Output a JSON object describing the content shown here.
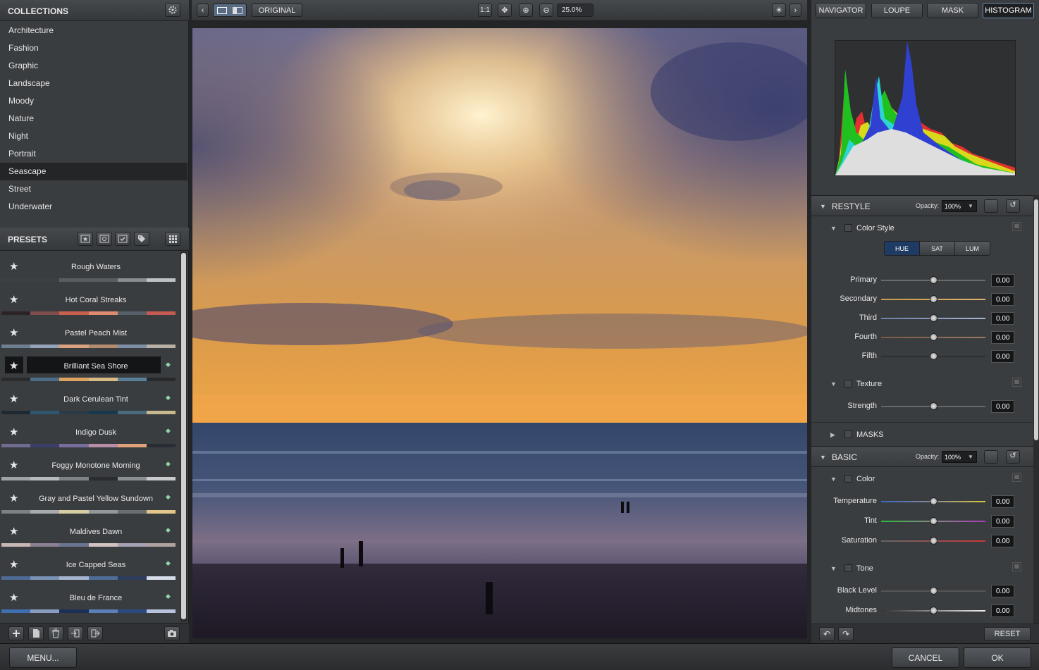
{
  "collections": {
    "title": "COLLECTIONS",
    "items": [
      "Architecture",
      "Fashion",
      "Graphic",
      "Landscape",
      "Moody",
      "Nature",
      "Night",
      "Portrait",
      "Seascape",
      "Street",
      "Underwater"
    ],
    "selected": "Seascape"
  },
  "presets": {
    "title": "PRESETS",
    "items": [
      {
        "name": "Rough Waters",
        "swatch": [
          "#3d4043",
          "#3d4043",
          "#5a5d60",
          "#5a5d60",
          "#8a8c8e",
          "#bfc1c3"
        ],
        "dot": false
      },
      {
        "name": "Hot Coral Streaks",
        "swatch": [
          "#2d2226",
          "#7f4d4c",
          "#c95f4f",
          "#e08a6f",
          "#55606b",
          "#c45a52"
        ],
        "dot": false
      },
      {
        "name": "Pastel Peach Mist",
        "swatch": [
          "#6f7f92",
          "#93a2b6",
          "#d9a17e",
          "#b38b6f",
          "#7e8fa5",
          "#b8b0a4"
        ],
        "dot": false
      },
      {
        "name": "Brilliant Sea Shore",
        "swatch": [
          "#2a2b2c",
          "#4b6d8a",
          "#dba35f",
          "#d7bb83",
          "#5a7f9a",
          "#27292b"
        ],
        "dot": true,
        "selected": true
      },
      {
        "name": "Dark Cerulean Tint",
        "swatch": [
          "#1e2a33",
          "#2f5870",
          "#2c3a47",
          "#18384d",
          "#4a6a7d",
          "#c9b98f"
        ],
        "dot": true
      },
      {
        "name": "Indigo Dusk",
        "swatch": [
          "#6f6c8f",
          "#3a3f67",
          "#7a6f9c",
          "#b88da6",
          "#e0a17a",
          "#2a2c34"
        ],
        "dot": true
      },
      {
        "name": "Foggy Monotone Morning",
        "swatch": [
          "#9fa3a6",
          "#b8bbbd",
          "#7f8386",
          "#2a2c2f",
          "#8b8f93",
          "#c7c9cb"
        ],
        "dot": true
      },
      {
        "name": "Gray and Pastel Yellow Sundown",
        "swatch": [
          "#7d8084",
          "#a9abad",
          "#d6cda3",
          "#95989b",
          "#6b6e72",
          "#e1c88a"
        ],
        "dot": true
      },
      {
        "name": "Maldives Dawn",
        "swatch": [
          "#c9b7b6",
          "#8c7f91",
          "#6b7590",
          "#d2c3c1",
          "#a8a1b3",
          "#b1a0a0"
        ],
        "dot": true
      },
      {
        "name": "Ice Capped Seas",
        "swatch": [
          "#4e6a97",
          "#7b92b7",
          "#a5b5cf",
          "#4f6d99",
          "#2d3d5e",
          "#d6dde8"
        ],
        "dot": true
      },
      {
        "name": "Bleu de France",
        "swatch": [
          "#3f6fb0",
          "#8a9bc0",
          "#1c3057",
          "#5c7fb8",
          "#2a4a80",
          "#b7c4dc"
        ],
        "dot": true
      }
    ]
  },
  "toolbar": {
    "original_label": "ORIGINAL",
    "one_to_one": "1:1",
    "zoom_value": "25.0%"
  },
  "tabs": [
    "NAVIGATOR",
    "LOUPE",
    "MASK",
    "HISTOGRAM"
  ],
  "active_tab": "HISTOGRAM",
  "restyle": {
    "title": "RESTYLE",
    "opacity_label": "Opacity:",
    "opacity_value": "100%",
    "color_style": "Color Style",
    "segments": [
      "HUE",
      "SAT",
      "LUM"
    ],
    "sliders": [
      {
        "label": "Primary",
        "value": "0.00"
      },
      {
        "label": "Secondary",
        "value": "0.00"
      },
      {
        "label": "Third",
        "value": "0.00"
      },
      {
        "label": "Fourth",
        "value": "0.00"
      },
      {
        "label": "Fifth",
        "value": "0.00"
      }
    ],
    "texture": "Texture",
    "strength_label": "Strength",
    "strength_value": "0.00",
    "masks": "MASKS"
  },
  "basic": {
    "title": "BASIC",
    "opacity_label": "Opacity:",
    "opacity_value": "100%",
    "color": "Color",
    "color_sliders": [
      {
        "label": "Temperature",
        "value": "0.00"
      },
      {
        "label": "Tint",
        "value": "0.00"
      },
      {
        "label": "Saturation",
        "value": "0.00"
      }
    ],
    "tone": "Tone",
    "tone_sliders": [
      {
        "label": "Black Level",
        "value": "0.00"
      },
      {
        "label": "Midtones",
        "value": "0.00"
      }
    ]
  },
  "footer": {
    "reset": "RESET",
    "menu": "MENU...",
    "cancel": "CANCEL",
    "ok": "OK"
  },
  "colors": {
    "accent_blue": "#1e3b63",
    "panel_bg": "#3a3d40",
    "selection_bg": "#232527"
  }
}
